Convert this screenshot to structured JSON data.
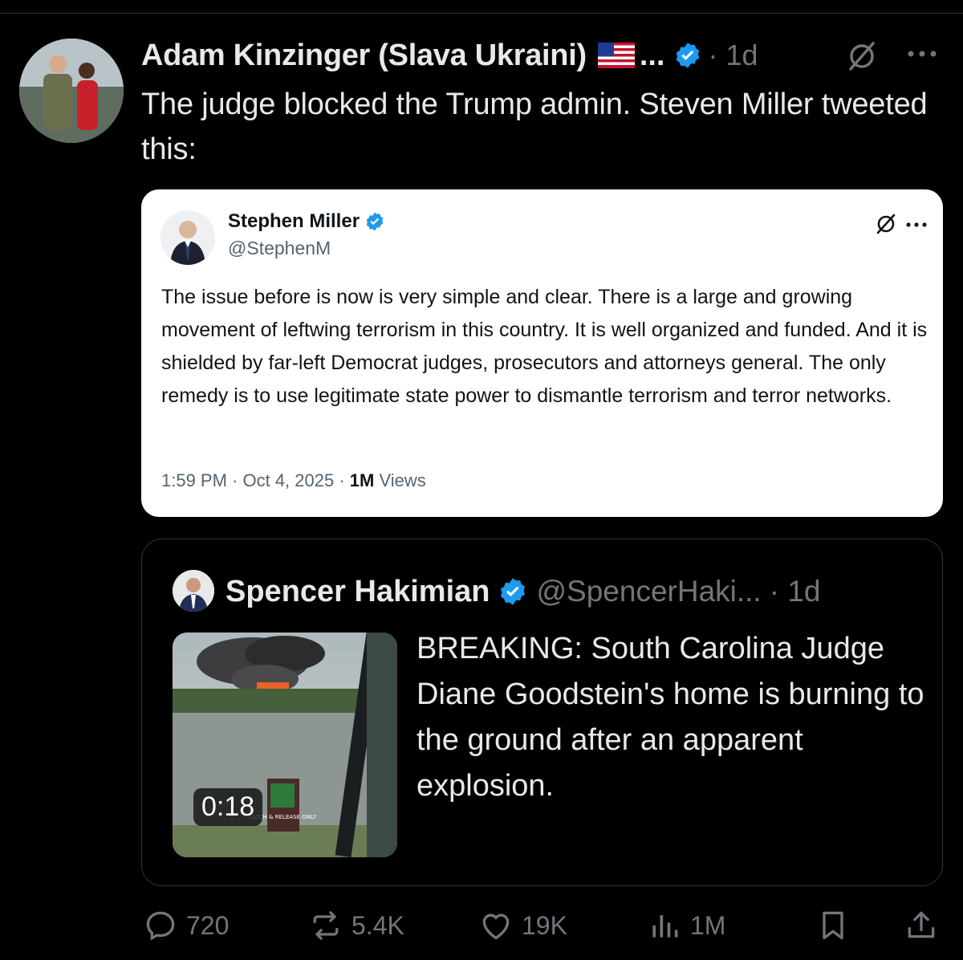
{
  "post": {
    "author_name": "Adam Kinzinger (Slava Ukraini)",
    "author_flag": "🇺🇸",
    "truncation": "...",
    "time": "· 1d",
    "text": "The judge blocked the Trump admin.  Steven Miller tweeted this:"
  },
  "embedded": {
    "name": "Stephen Miller",
    "handle": "@StephenM",
    "text": "The issue before is now is very simple and clear. There is a large and growing movement of leftwing terrorism in this country. It is well organized and funded. And it is shielded by far-left Democrat judges, prosecutors and attorneys general. The only remedy is to use legitimate state power to dismantle terrorism and terror networks.",
    "meta_time": "1:59 PM · Oct 4, 2025 · ",
    "meta_views_count": "1M",
    "meta_views_label": " Views"
  },
  "quote": {
    "name": "Spencer Hakimian",
    "handle": "@SpencerHaki...",
    "time": "· 1d",
    "text": "BREAKING: South Carolina Judge Diane Goodstein's home is burning to the ground after an apparent explosion.",
    "video_duration": "0:18",
    "sign_text": "CATCH & RELEASE ONLY"
  },
  "actions": {
    "replies": "720",
    "reposts": "5.4K",
    "likes": "19K",
    "views": "1M"
  },
  "colors": {
    "background": "#000000",
    "text_primary": "#e7e9ea",
    "text_secondary": "#71767b",
    "verified": "#1d9bf0",
    "divider": "#2f3336"
  },
  "icons": [
    "grok-icon",
    "more-icon",
    "verified-badge-icon",
    "reply-icon",
    "repost-icon",
    "like-icon",
    "views-icon",
    "bookmark-icon",
    "share-icon"
  ]
}
